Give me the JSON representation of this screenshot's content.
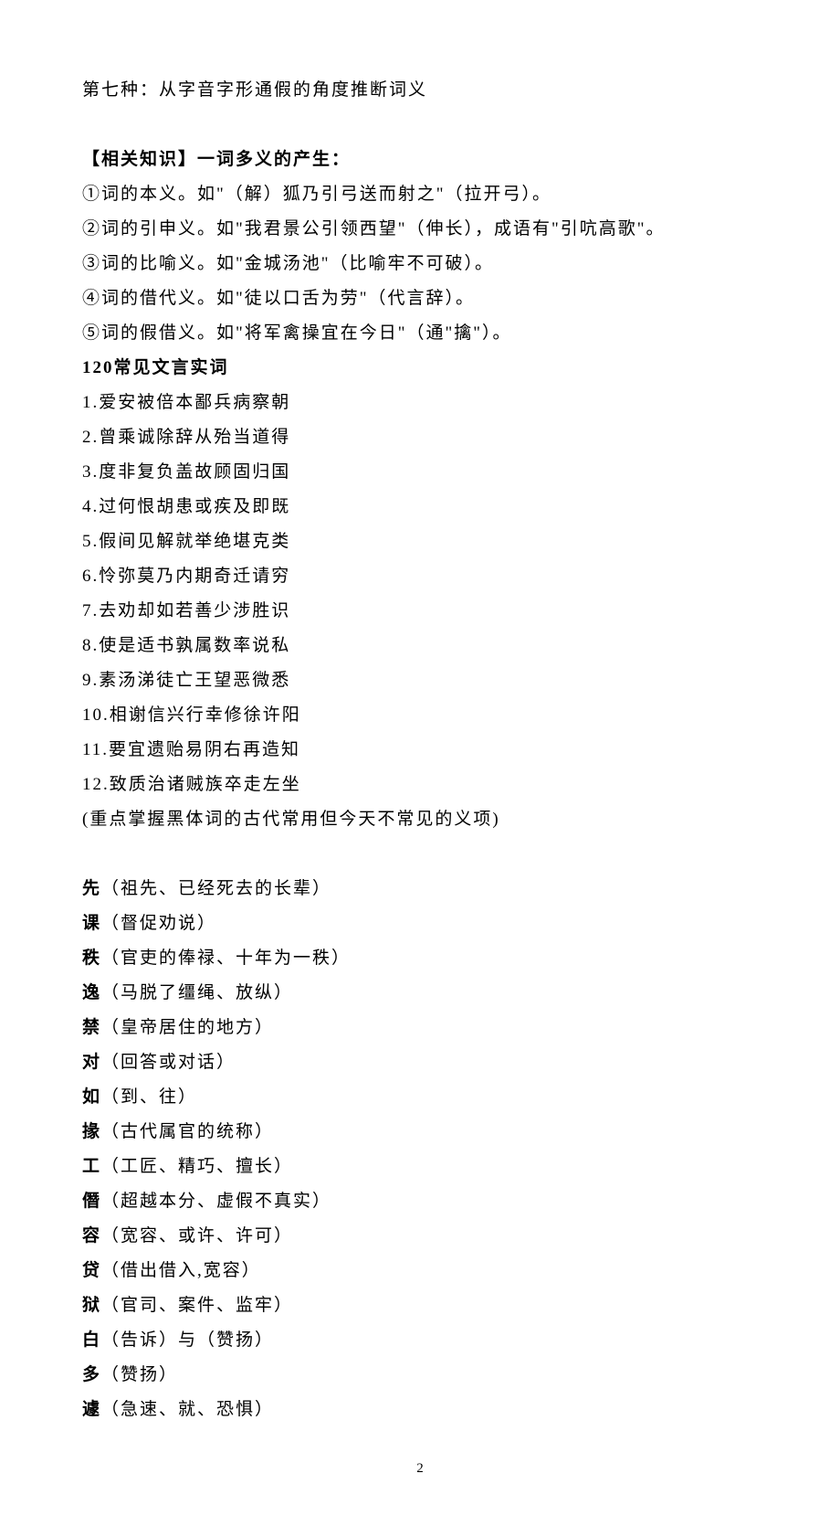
{
  "top_line": "第七种：从字音字形通假的角度推断词义",
  "heading1": "【相关知识】一词多义的产生：",
  "meaning_lines": [
    "①词的本义。如\"（解）狐乃引弓送而射之\"（拉开弓）。",
    "②词的引申义。如\"我君景公引领西望\"（伸长），成语有\"引吭高歌\"。",
    "③词的比喻义。如\"金城汤池\"（比喻牢不可破）。",
    "④词的借代义。如\"徒以口舌为劳\"（代言辞）。",
    "⑤词的假借义。如\"将军禽操宜在今日\"（通\"擒\"）。"
  ],
  "heading2": "120常见文言实词",
  "char_groups": [
    "1.爱安被倍本鄙兵病察朝",
    "2.曾乘诚除辞从殆当道得",
    "3.度非复负盖故顾固归国",
    "4.过何恨胡患或疾及即既",
    "5.假间见解就举绝堪克类",
    "6.怜弥莫乃内期奇迁请穷",
    "7.去劝却如若善少涉胜识",
    "8.使是适书孰属数率说私",
    "9.素汤涕徒亡王望恶微悉",
    "10.相谢信兴行幸修徐许阳",
    "11.要宜遗贻易阴右再造知",
    "12.致质治诸贼族卒走左坐"
  ],
  "note_line": "(重点掌握黑体词的古代常用但今天不常见的义项)",
  "word_entries": [
    {
      "term": "先",
      "def": "（祖先、已经死去的长辈）"
    },
    {
      "term": "课",
      "def": "（督促劝说）"
    },
    {
      "term": "秩",
      "def": "（官吏的俸禄、十年为一秩）"
    },
    {
      "term": "逸",
      "def": "（马脱了缰绳、放纵）"
    },
    {
      "term": "禁",
      "def": "（皇帝居住的地方）"
    },
    {
      "term": "对",
      "def": "（回答或对话）"
    },
    {
      "term": "如",
      "def": "（到、往）"
    },
    {
      "term": "掾",
      "def": "（古代属官的统称）"
    },
    {
      "term": "工",
      "def": "（工匠、精巧、擅长）"
    },
    {
      "term": "僭",
      "def": "（超越本分、虚假不真实）"
    },
    {
      "term": "容",
      "def": "（宽容、或许、许可）"
    },
    {
      "term": "贷",
      "def": "（借出借入,宽容）"
    },
    {
      "term": "狱",
      "def": "（官司、案件、监牢）"
    },
    {
      "term": "白",
      "def": "（告诉）与（赞扬）"
    },
    {
      "term": "多",
      "def": "（赞扬）"
    },
    {
      "term": "遽",
      "def": "（急速、就、恐惧）"
    }
  ],
  "page_number": "2"
}
